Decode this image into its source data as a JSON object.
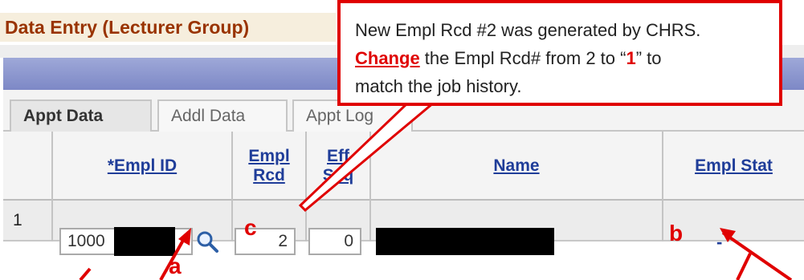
{
  "page": {
    "title": "Data Entry (Lecturer Group)"
  },
  "tabs": [
    {
      "label": "Appt Data",
      "active": true
    },
    {
      "label": "Addl Data",
      "active": false
    },
    {
      "label": "Appt Log",
      "active": false
    }
  ],
  "grid": {
    "columns": {
      "empl_id": "*Empl ID",
      "empl_rcd": [
        "Empl",
        "Rcd"
      ],
      "eff_seq": [
        "Eff",
        "Seq"
      ],
      "name": "Name",
      "empl_stat": "Empl Stat"
    },
    "row": {
      "row_number": "1",
      "empl_id_prefix": "1000",
      "empl_rcd": "2",
      "eff_seq": "0",
      "empl_stat": "-"
    }
  },
  "annotations": {
    "callout": {
      "line1": "New Empl Rcd #2 was generated by CHRS.",
      "change_word": "Change",
      "line2_mid": " the Empl Rcd# from 2 to “",
      "one": "1",
      "line2_end": "” to",
      "line3": "match the job history."
    },
    "marker_a": "a",
    "marker_b": "b",
    "marker_c": "c"
  },
  "colors": {
    "title": "#993300",
    "link": "#1f3d99",
    "annotation": "#e00000",
    "header_bar": "#7d88c6"
  },
  "icons": {
    "lookup": "magnifier-icon"
  }
}
